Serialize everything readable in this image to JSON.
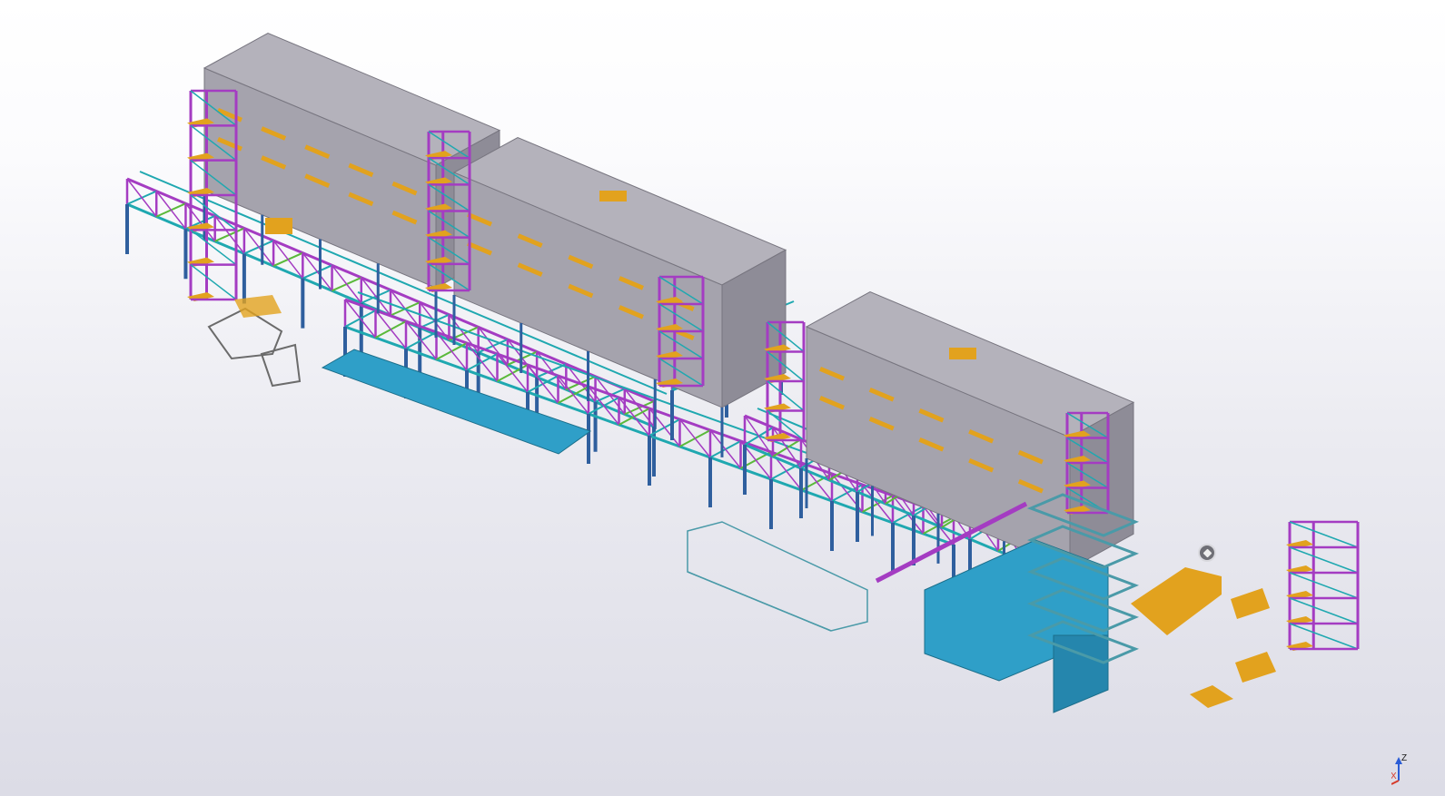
{
  "viewport": {
    "background_top": "#ffffff",
    "background_bottom": "#dcdce6"
  },
  "palette": {
    "cladding": "#a5a3ad",
    "cladding_dark": "#8e8c97",
    "column": "#2f5f9e",
    "brace_magenta": "#a43cc2",
    "brace_cyan": "#1fa8b0",
    "brace_green": "#5ab93a",
    "plate_orange": "#e2a21e",
    "floor_blue": "#2f9fc8",
    "equipment_outline": "#4a9aa8"
  },
  "nav_cube": {
    "icon": "navigation-cube-icon"
  },
  "axis_triad": {
    "x_label": "X",
    "z_label": "Z"
  }
}
